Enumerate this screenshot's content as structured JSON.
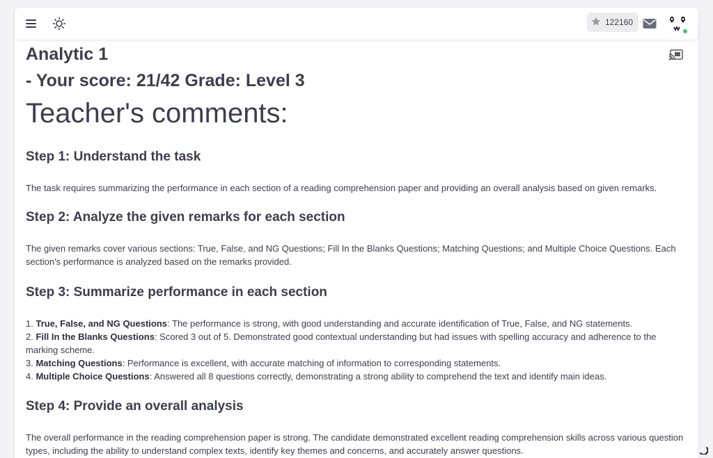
{
  "header": {
    "points_value": "122160",
    "icons": [
      "menu-icon",
      "sun-icon",
      "star-icon",
      "mail-icon",
      "avatar",
      "cast-icon"
    ]
  },
  "page": {
    "title": "Analytic 1",
    "score_line": "- Your score: 21/42 Grade: Level 3",
    "comments_heading": "Teacher's comments:"
  },
  "steps": [
    {
      "heading": "Step 1: Understand the task",
      "text": "The task requires summarizing the performance in each section of a reading comprehension paper and providing an overall analysis based on given remarks."
    },
    {
      "heading": "Step 2: Analyze the given remarks for each section",
      "text": "The given remarks cover various sections: True, False, and NG Questions; Fill In the Blanks Questions; Matching Questions; and Multiple Choice Questions. Each section's performance is analyzed based on the remarks provided."
    },
    {
      "heading": "Step 3: Summarize performance in each section",
      "items": [
        {
          "num": "1.",
          "bold": "True, False, and NG Questions",
          "text": ": The performance is strong, with good understanding and accurate identification of True, False, and NG statements."
        },
        {
          "num": "2.",
          "bold": "Fill In the Blanks Questions",
          "text": ": Scored 3 out of 5. Demonstrated good contextual understanding but had issues with spelling accuracy and adherence to the marking scheme."
        },
        {
          "num": "3.",
          "bold": "Matching Questions",
          "text": ": Performance is excellent, with accurate matching of information to corresponding statements."
        },
        {
          "num": "4.",
          "bold": "Multiple Choice Questions",
          "text": ": Answered all 8 questions correctly, demonstrating a strong ability to comprehend the text and identify main ideas."
        }
      ]
    },
    {
      "heading": "Step 4: Provide an overall analysis",
      "text": "The overall performance in the reading comprehension paper is strong. The candidate demonstrated excellent reading comprehension skills across various question types, including the ability to understand complex texts, identify key themes and concerns, and accurately answer questions."
    }
  ],
  "colors": {
    "background": "#f3f3f5",
    "text": "#3d3d4e",
    "online": "#3ec55f"
  }
}
